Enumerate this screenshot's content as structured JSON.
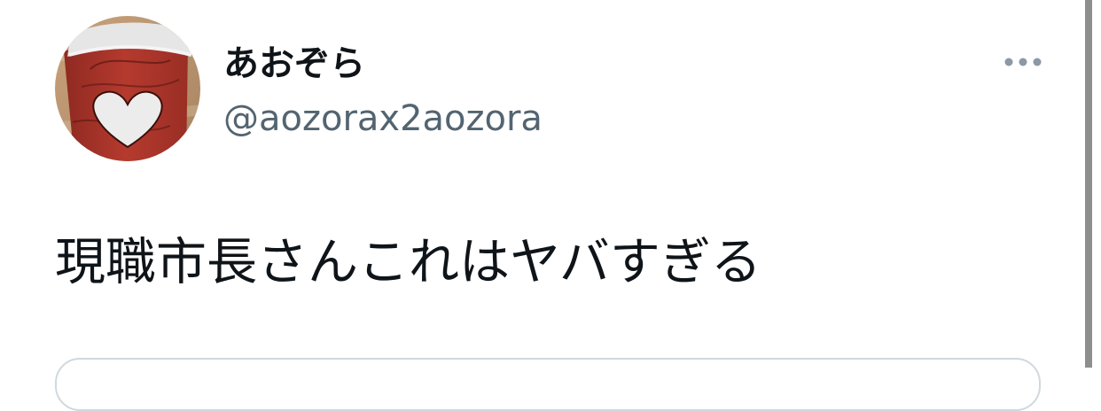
{
  "tweet": {
    "author": {
      "display_name": "あおぞら",
      "handle": "@aozorax2aozora"
    },
    "text": "現職市長さんこれはヤバすぎる",
    "more_icon": "more-horizontal-icon"
  },
  "colors": {
    "text_primary": "#0f1419",
    "text_secondary": "#536471",
    "icon_gray": "#8b98a5",
    "border": "#cfd9de"
  }
}
